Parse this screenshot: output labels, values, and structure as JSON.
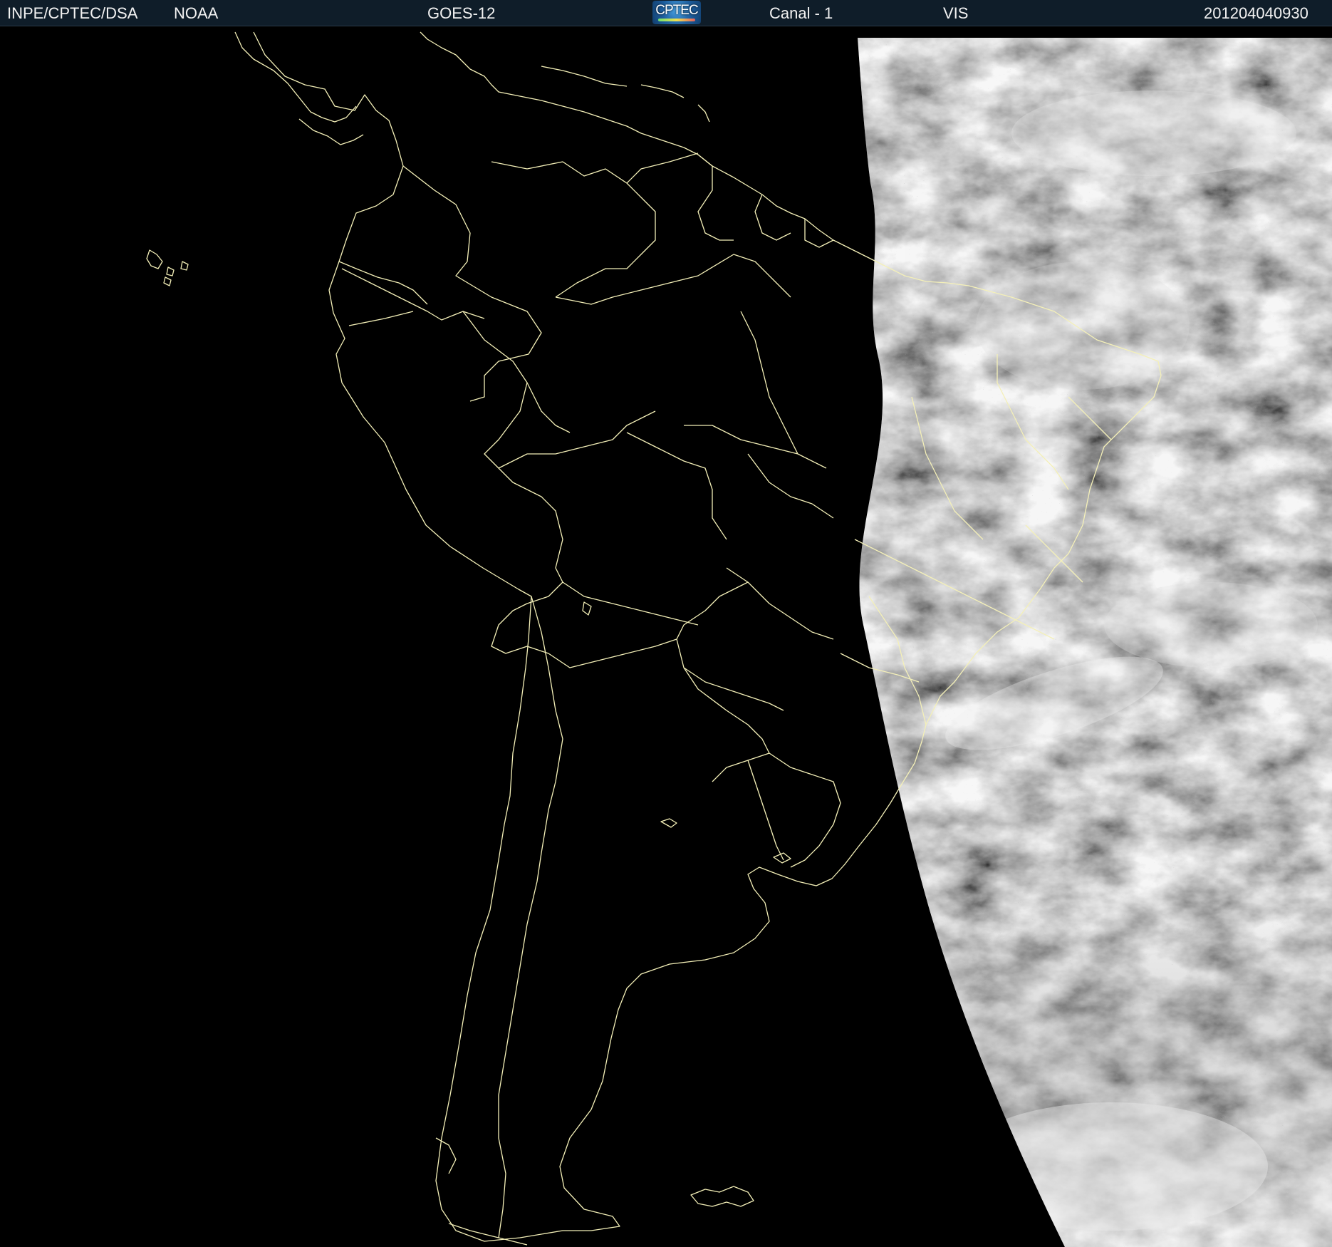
{
  "header": {
    "institution": "INPE/CPTEC/DSA",
    "agency": "NOAA",
    "satellite": "GOES-12",
    "logo_text": "CPTEC",
    "channel": "Canal - 1",
    "band": "VIS",
    "timestamp": "201204040930"
  },
  "colors": {
    "header_bg": "#0f1d29",
    "border_lines": "#f4f0b8",
    "space": "#000000",
    "clouds": "#c8c8c8"
  },
  "layers": [
    "satellite-visible-imagery",
    "country-borders",
    "state-borders",
    "coastlines"
  ]
}
